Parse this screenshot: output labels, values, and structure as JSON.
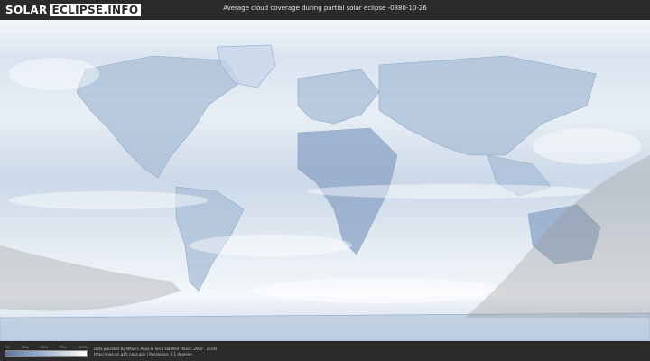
{
  "header": {
    "logo_part1": "SOLAR",
    "logo_part2": "ECLIPSE.INFO",
    "title": "Average cloud coverage during partial solar eclipse -0880-10-26"
  },
  "legend": {
    "ticks": [
      "0%",
      "25%",
      "50%",
      "75%",
      "100%"
    ],
    "colors": {
      "low": "#5b7598",
      "mid": "#a6b9d3",
      "high": "#ffffff"
    }
  },
  "credits": {
    "line1": "Data provided by NASA's Aqua & Terra satellite (Years: 2000 - 2019)",
    "line2": "https://neo.sci.gsfc.nasa.gov | Resolution: 0.1 degrees"
  },
  "colors": {
    "background": "#2b2b2b",
    "cloud_base": "#dfe8f2",
    "cloud_dark": "#7f9cc2",
    "night_overlay": "#9a9a9a"
  }
}
